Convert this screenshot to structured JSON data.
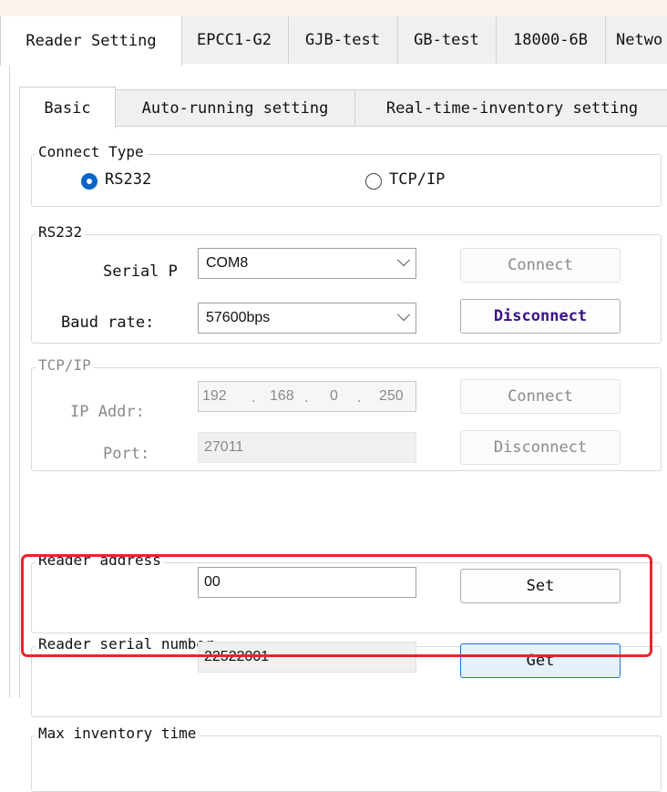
{
  "outer_tabs": [
    "Reader Setting",
    "EPCC1-G2",
    "GJB-test",
    "GB-test",
    "18000-6B",
    "Netwo"
  ],
  "inner_tabs": [
    "Basic",
    "Auto-running setting",
    "Real-time-inventory setting"
  ],
  "connect_type": {
    "legend": "Connect Type",
    "options": [
      "RS232",
      "TCP/IP"
    ],
    "selected": "RS232"
  },
  "rs232": {
    "legend": "RS232",
    "serial_port_label": "Serial P",
    "serial_port_value": "COM8",
    "baud_rate_label": "Baud rate:",
    "baud_rate_value": "57600bps",
    "connect_label": "Connect",
    "disconnect_label": "Disconnect"
  },
  "tcpip": {
    "legend": "TCP/IP",
    "ip_label": "IP Addr:",
    "ip_octets": [
      "192",
      "168",
      "0",
      "250"
    ],
    "ip_dot": ".",
    "port_label": "Port:",
    "port_value": "27011",
    "connect_label": "Connect",
    "disconnect_label": "Disconnect"
  },
  "reader_address": {
    "legend": "Reader address",
    "value": "00",
    "set_label": "Set"
  },
  "reader_serial": {
    "legend": "Reader serial number",
    "value": "22522001",
    "get_label": "Get"
  },
  "max_inventory": {
    "legend": "Max inventory time"
  },
  "colors": {
    "highlight": "#e8252a",
    "radio_selected": "#0a63c9",
    "disconnect_text": "#3c1384",
    "focus_button_border": "#1976d2"
  }
}
